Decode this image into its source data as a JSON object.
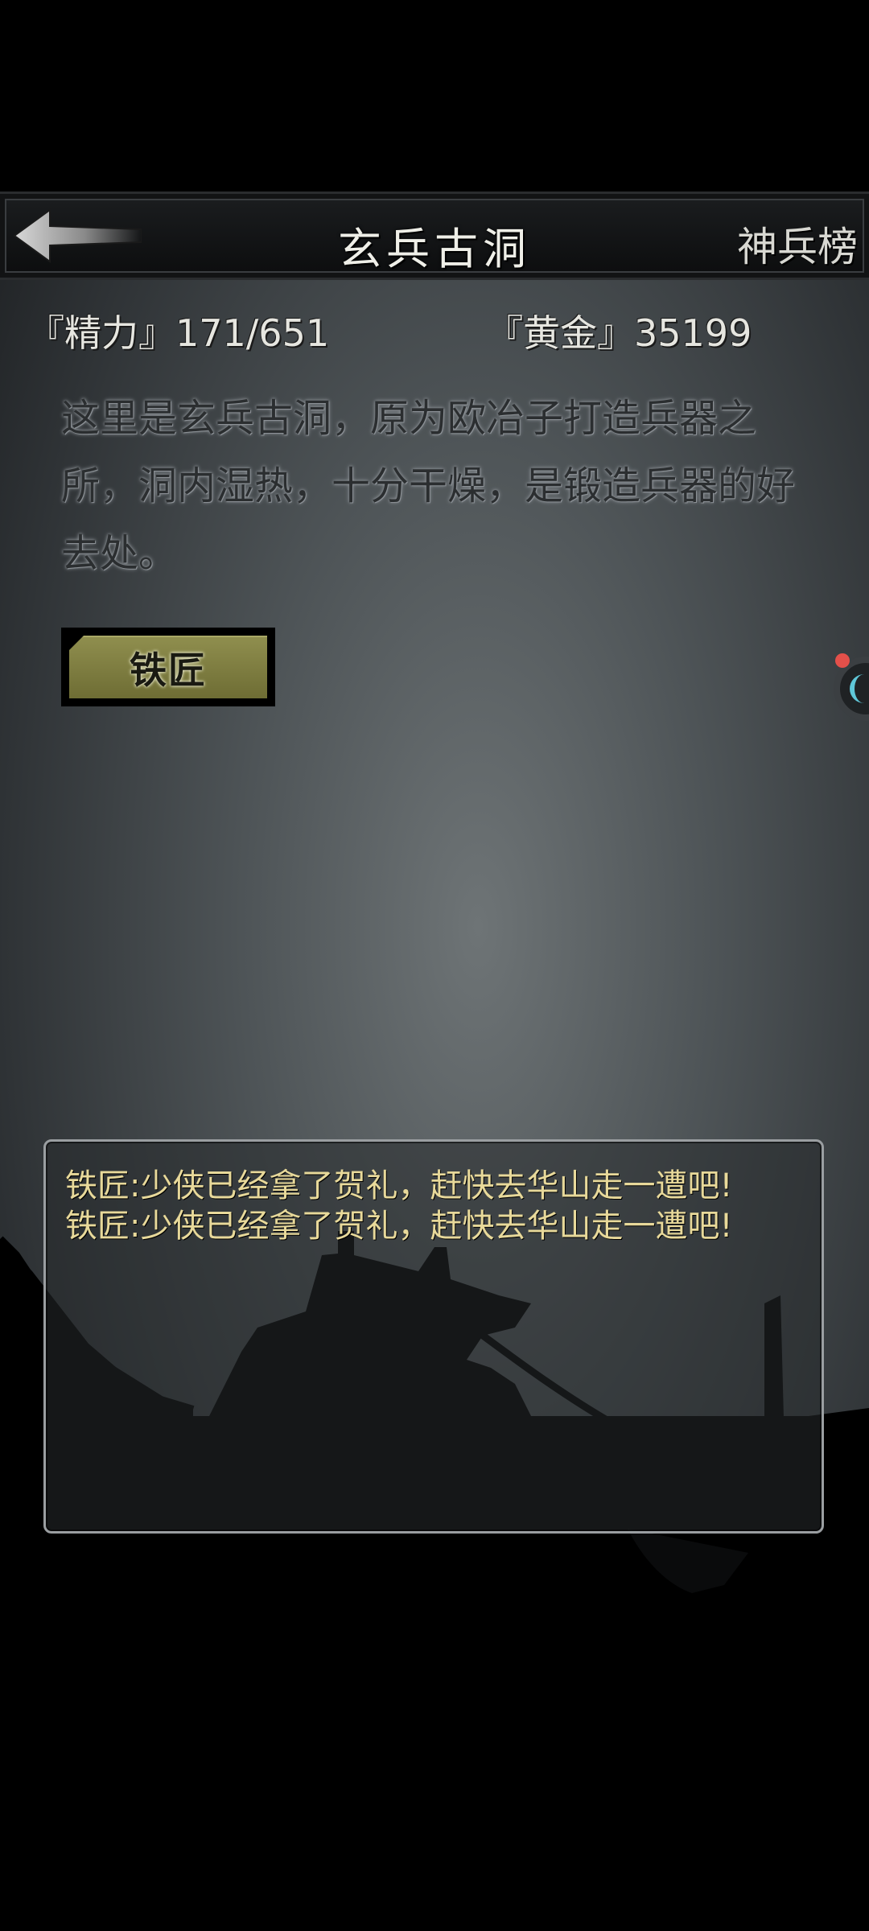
{
  "header": {
    "back_icon": "back-arrow-icon",
    "title": "玄兵古洞",
    "right_label": "神兵榜"
  },
  "stats": {
    "energy": "『精力』171/651",
    "gold": "『黄金』35199"
  },
  "description": "这里是玄兵古洞，原为欧冶子打造兵器之所，洞内湿热，十分干燥，是锻造兵器的好去处。",
  "actions": {
    "smith_label": "铁匠"
  },
  "log": {
    "lines": [
      "铁匠:少侠已经拿了贺礼，赶快去华山走一遭吧!",
      "铁匠:少侠已经拿了贺礼，赶快去华山走一遭吧!"
    ]
  },
  "colors": {
    "accent_button": "#8f8e4e",
    "log_text": "#e8d99a",
    "notification_dot": "#e4504a",
    "widget_arc": "#5fc7d8"
  }
}
